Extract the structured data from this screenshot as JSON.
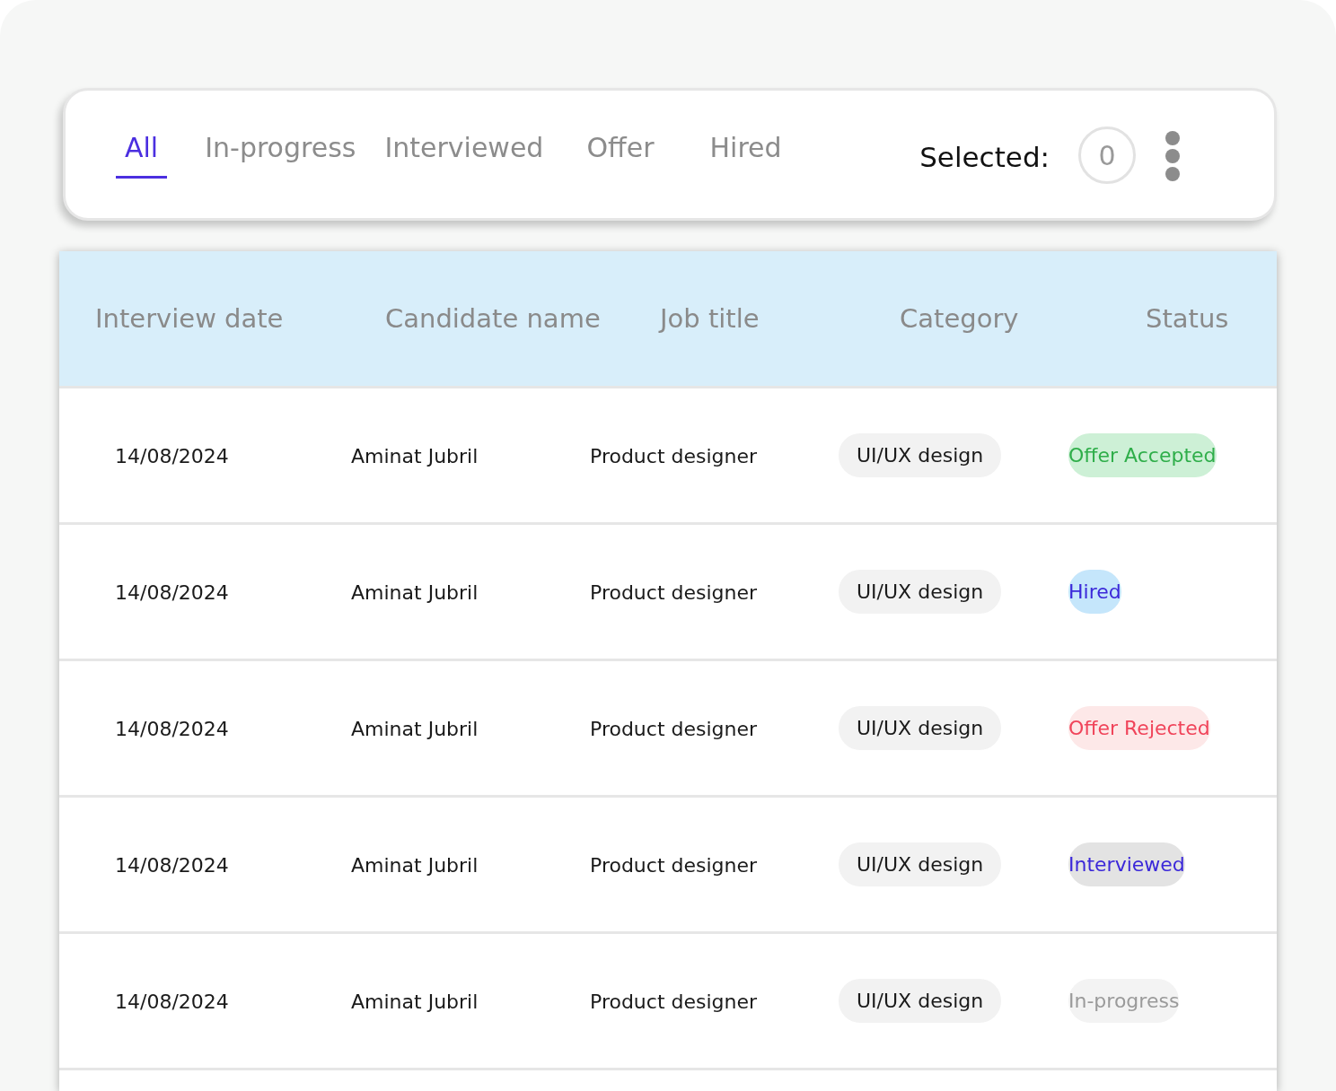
{
  "tabs": [
    {
      "label": "All",
      "selected": true
    },
    {
      "label": "In-progress",
      "selected": false
    },
    {
      "label": "Interviewed",
      "selected": false
    },
    {
      "label": "Offer",
      "selected": false
    },
    {
      "label": "Hired",
      "selected": false
    }
  ],
  "selection": {
    "label": "Selected:",
    "count": "0"
  },
  "table": {
    "columns": [
      "Interview date",
      "Candidate name",
      "Job title",
      "Category",
      "Status"
    ],
    "rows": [
      {
        "date": "14/08/2024",
        "name": "Aminat Jubril",
        "job": "Product designer",
        "category": "UI/UX design",
        "status": {
          "label": "Offer Accepted",
          "kind": "accepted"
        }
      },
      {
        "date": "14/08/2024",
        "name": "Aminat Jubril",
        "job": "Product designer",
        "category": "UI/UX design",
        "status": {
          "label": "Hired",
          "kind": "hired"
        }
      },
      {
        "date": "14/08/2024",
        "name": "Aminat Jubril",
        "job": "Product designer",
        "category": "UI/UX design",
        "status": {
          "label": "Offer Rejected",
          "kind": "rejected"
        }
      },
      {
        "date": "14/08/2024",
        "name": "Aminat Jubril",
        "job": "Product designer",
        "category": "UI/UX design",
        "status": {
          "label": "Interviewed",
          "kind": "interviewed"
        }
      },
      {
        "date": "14/08/2024",
        "name": "Aminat Jubril",
        "job": "Product designer",
        "category": "UI/UX design",
        "status": {
          "label": "In-progress",
          "kind": "progress"
        }
      }
    ]
  }
}
